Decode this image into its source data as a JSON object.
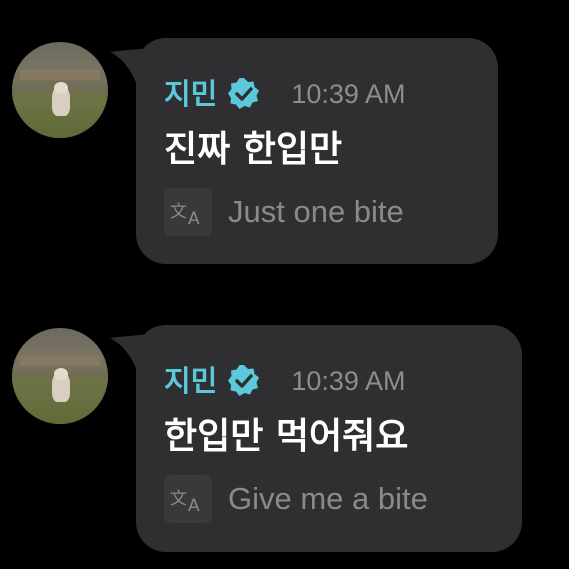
{
  "messages": [
    {
      "sender": "지민",
      "verified_icon": "verified-badge-icon",
      "time": "10:39 AM",
      "text": "진짜 한입만",
      "translate_icon": "translate-icon",
      "translation": "Just one bite"
    },
    {
      "sender": "지민",
      "verified_icon": "verified-badge-icon",
      "time": "10:39 AM",
      "text": "한입만 먹어줘요",
      "translate_icon": "translate-icon",
      "translation": "Give me a bite"
    }
  ],
  "colors": {
    "background": "#000000",
    "bubble": "#2f2f31",
    "sender": "#5cc8dc",
    "verified": "#5cc8dc",
    "time": "#8d8d8f",
    "message_text": "#ffffff",
    "translation_text": "#8a8a8c"
  }
}
